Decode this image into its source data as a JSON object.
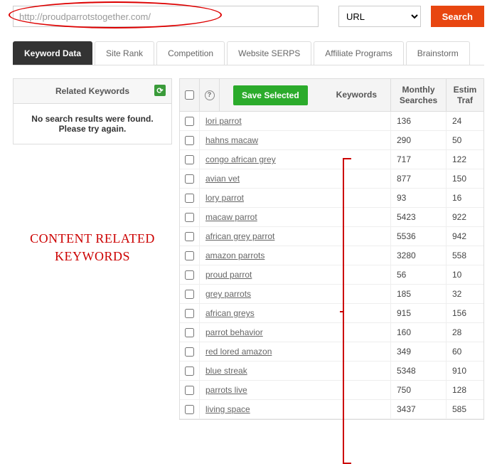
{
  "search": {
    "url_value": "http://proudparrotstogether.com/",
    "select_label": "URL",
    "button_label": "Search"
  },
  "tabs": [
    {
      "label": "Keyword Data",
      "active": true
    },
    {
      "label": "Site Rank",
      "active": false
    },
    {
      "label": "Competition",
      "active": false
    },
    {
      "label": "Website SERPS",
      "active": false
    },
    {
      "label": "Affiliate Programs",
      "active": false
    },
    {
      "label": "Brainstorm",
      "active": false
    }
  ],
  "sidebar": {
    "panel_title": "Related Keywords",
    "no_results_line1": "No search results were found.",
    "no_results_line2": "Please try again."
  },
  "annotation": {
    "line1": "CONTENT RELATED",
    "line2": "KEYWORDS"
  },
  "table": {
    "save_button": "Save Selected",
    "col_keywords": "Keywords",
    "col_monthly": "Monthly Searches",
    "col_traffic": "Estimated Traffic",
    "rows": [
      {
        "keyword": "lori parrot",
        "monthly": "136",
        "traffic": "24"
      },
      {
        "keyword": "hahns macaw",
        "monthly": "290",
        "traffic": "50"
      },
      {
        "keyword": "congo african grey",
        "monthly": "717",
        "traffic": "122"
      },
      {
        "keyword": "avian vet",
        "monthly": "877",
        "traffic": "150"
      },
      {
        "keyword": "lory parrot",
        "monthly": "93",
        "traffic": "16"
      },
      {
        "keyword": "macaw parrot",
        "monthly": "5423",
        "traffic": "922"
      },
      {
        "keyword": "african grey parrot",
        "monthly": "5536",
        "traffic": "942"
      },
      {
        "keyword": "amazon parrots",
        "monthly": "3280",
        "traffic": "558"
      },
      {
        "keyword": "proud parrot",
        "monthly": "56",
        "traffic": "10"
      },
      {
        "keyword": "grey parrots",
        "monthly": "185",
        "traffic": "32"
      },
      {
        "keyword": "african greys",
        "monthly": "915",
        "traffic": "156"
      },
      {
        "keyword": "parrot behavior",
        "monthly": "160",
        "traffic": "28"
      },
      {
        "keyword": "red lored amazon",
        "monthly": "349",
        "traffic": "60"
      },
      {
        "keyword": "blue streak",
        "monthly": "5348",
        "traffic": "910"
      },
      {
        "keyword": "parrots live",
        "monthly": "750",
        "traffic": "128"
      },
      {
        "keyword": "living space",
        "monthly": "3437",
        "traffic": "585"
      }
    ]
  }
}
